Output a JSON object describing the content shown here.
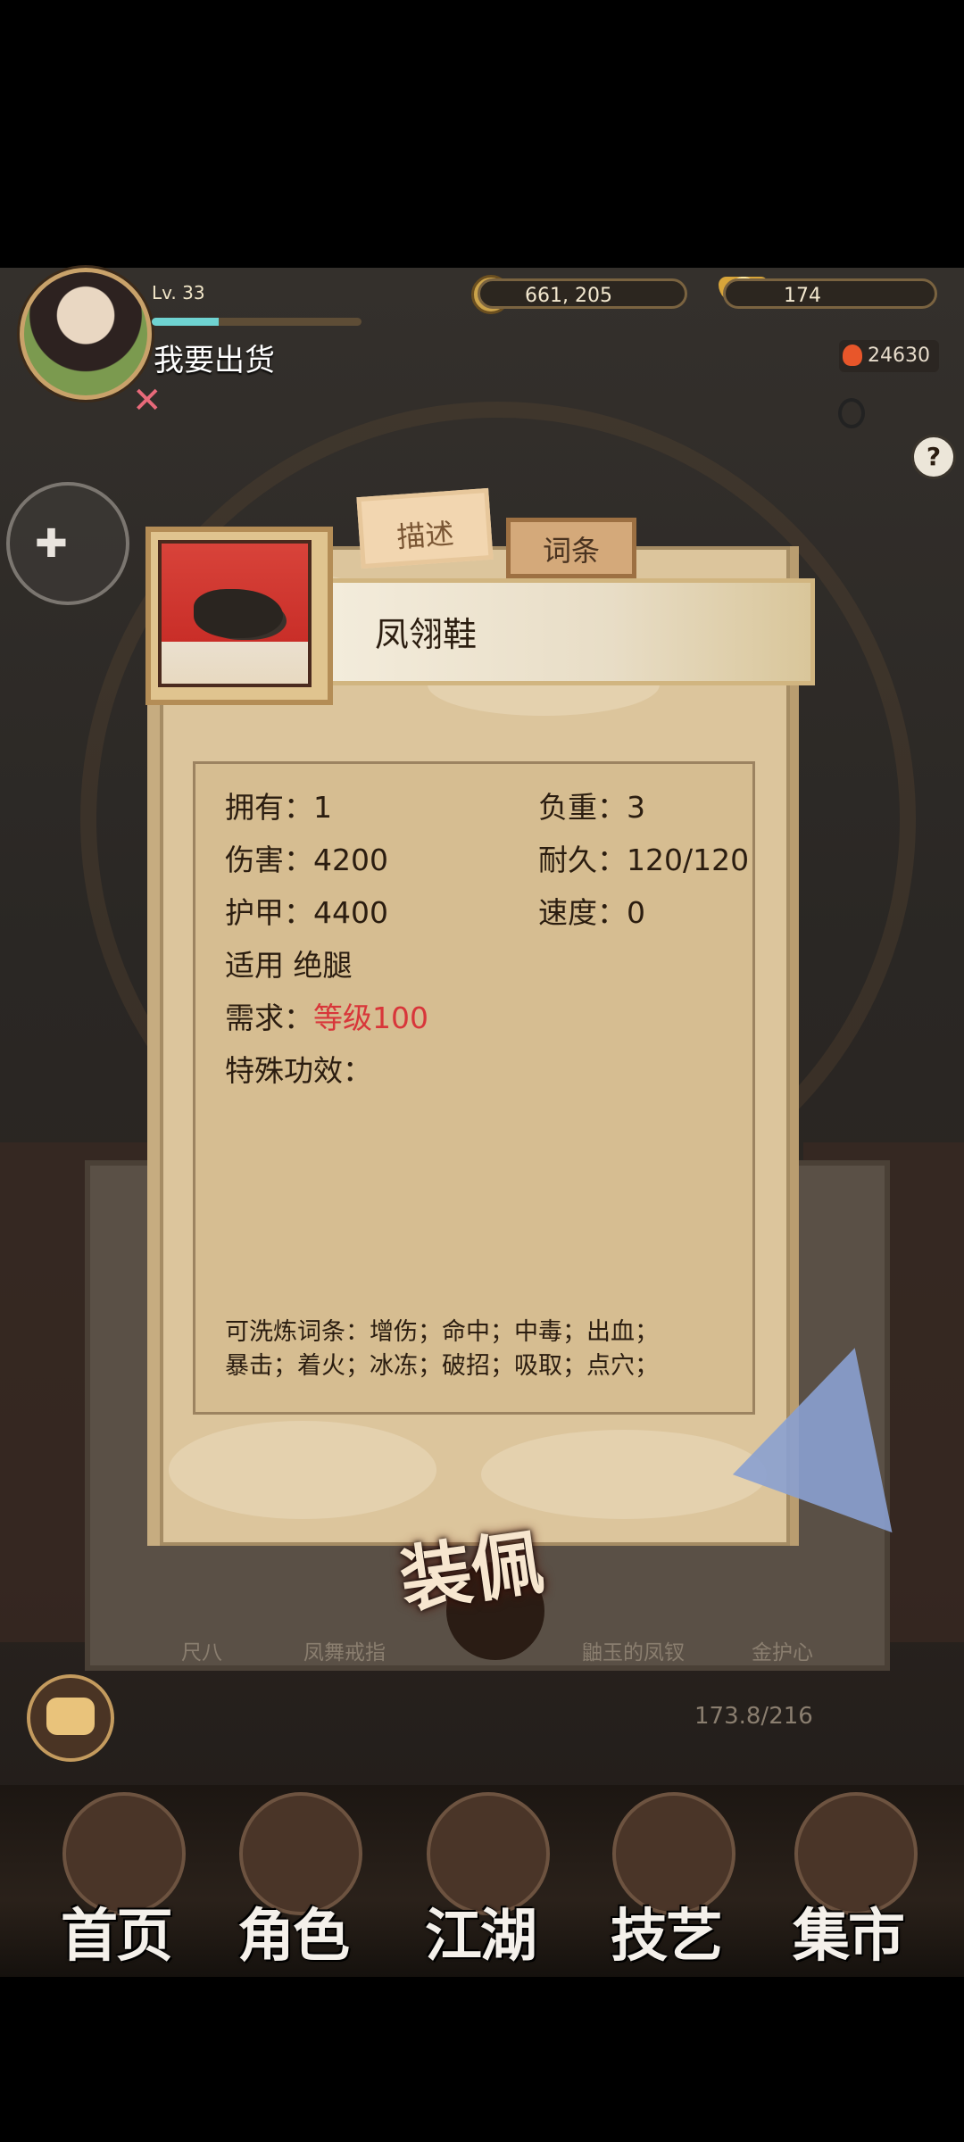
{
  "player": {
    "level": "Lv. 33",
    "level_progress": 0.32,
    "name": "我要出货"
  },
  "currency": {
    "coins": "661, 205",
    "ingots": "174",
    "combat_power": "24630"
  },
  "dialog": {
    "tabs": [
      "描述",
      "词条"
    ],
    "active_tab": "描述",
    "item_name": "凤翎鞋",
    "stats": {
      "own": "拥有：1",
      "weight": "负重：3",
      "damage": "伤害：4200",
      "durability": "耐久：120/120",
      "armor": "护甲：4400",
      "speed": "速度：0",
      "usable": "适用 绝腿",
      "req_label": "需求：",
      "req_value": "等级100",
      "special": "特殊功效："
    },
    "wash_line1": "可洗炼词条：增伤；命中；中毒；出血；",
    "wash_line2": "暴击；着火；冰冻；破招；吸取；点穴；"
  },
  "equip_button": "装佩",
  "bottom_items": [
    "尺八",
    "凤舞戒指",
    "鼬玉的凤钗",
    "金护心"
  ],
  "capacity": "173.8/216",
  "nav": [
    "首页",
    "角色",
    "江湖",
    "技艺",
    "集市"
  ],
  "colors": {
    "accent_red": "#d8363a",
    "parchment": "#dcc59c",
    "level_bar": "#6fd3d1"
  },
  "icons": [
    "gamepad-icon",
    "help-icon",
    "crossed-swords-icon",
    "ring-icon",
    "coin-icon",
    "ingot-icon",
    "flame-icon",
    "chat-icon",
    "shoe-item-icon"
  ]
}
